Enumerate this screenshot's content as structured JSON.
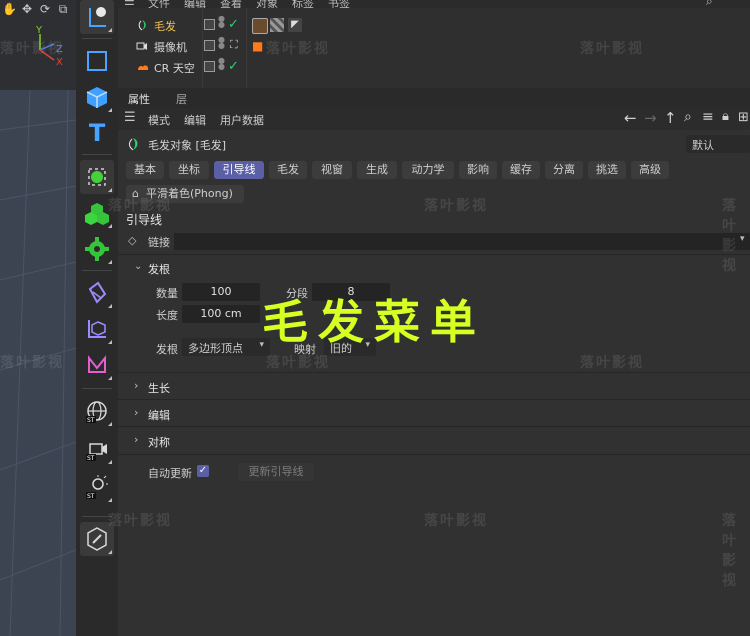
{
  "menubar": {
    "items": [
      "文件",
      "编辑",
      "查看",
      "对象",
      "标签",
      "书签"
    ]
  },
  "objects": [
    {
      "name": "毛发",
      "selected": true
    },
    {
      "name": "摄像机",
      "selected": false
    },
    {
      "name": "CR 天空",
      "selected": false
    }
  ],
  "viewport": {
    "axis_y": "Y",
    "axis_z": "Z",
    "axis_x": "X"
  },
  "panel_tabs": [
    "属性",
    "层"
  ],
  "attr_menu": [
    "模式",
    "编辑",
    "用户数据"
  ],
  "object_title": "毛发对象 [毛发]",
  "preset": "默认",
  "prop_tabs": [
    "基本",
    "坐标",
    "引导线",
    "毛发",
    "视窗",
    "生成",
    "动力学",
    "影响",
    "缓存",
    "分离",
    "挑选",
    "高级"
  ],
  "active_tab": "引导线",
  "phong_tab": "平滑着色(Phong)",
  "section_heading": "引导线",
  "link_label": "链接",
  "root_group": {
    "title": "发根",
    "count_label": "数量",
    "count_value": "100",
    "segments_label": "分段",
    "segments_value": "8",
    "length_label": "长度",
    "length_value": "100 cm",
    "root_label": "发根",
    "root_value": "多边形顶点",
    "map_label": "映射",
    "map_value": "旧的"
  },
  "collapsed_groups": [
    "生长",
    "编辑",
    "对称"
  ],
  "auto_update_label": "自动更新",
  "auto_update_checked": true,
  "update_button": "更新引导线",
  "overlay_title": "毛发菜单",
  "watermark": "落叶影视",
  "colors": {
    "accent": "#5a5fa6",
    "overlay": "#d6ff22",
    "check": "#2bd36b"
  }
}
